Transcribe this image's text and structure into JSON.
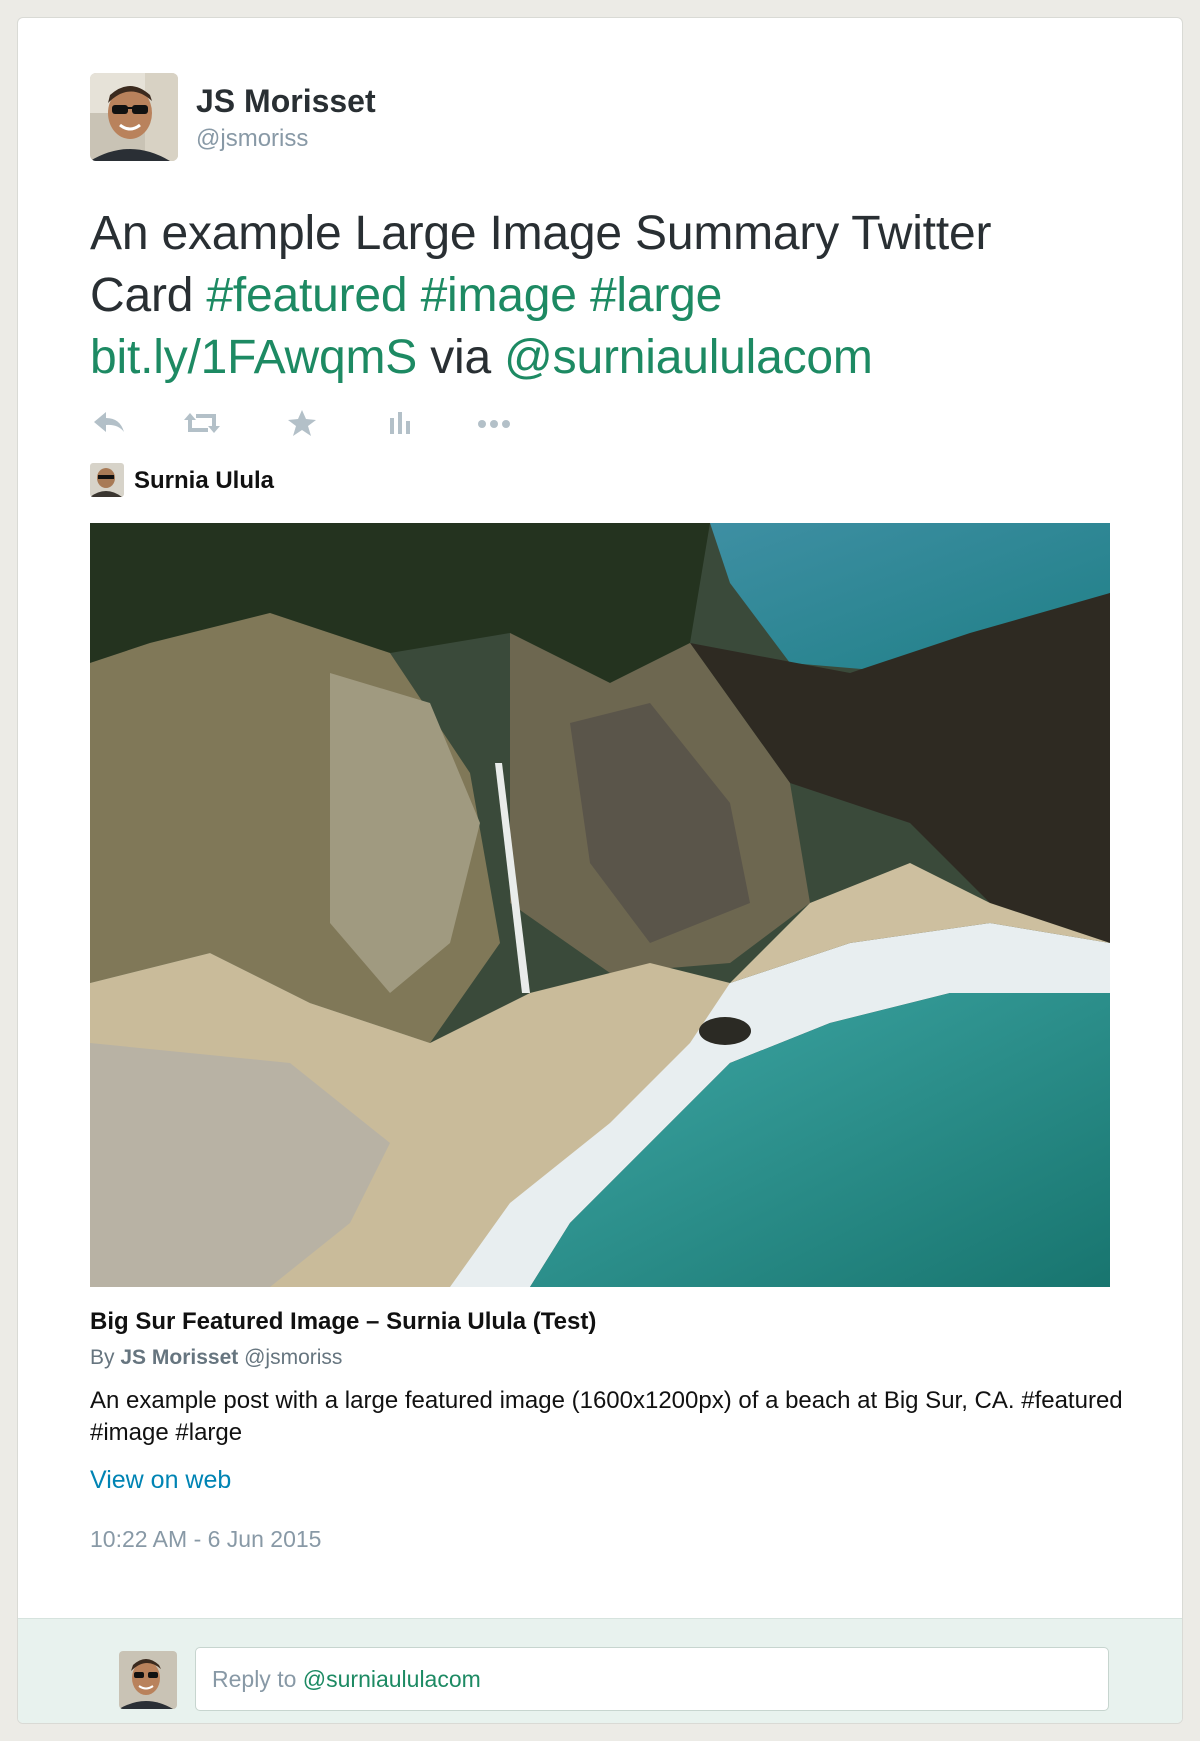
{
  "tweet": {
    "author_name": "JS Morisset",
    "author_handle": "@jsmoriss",
    "text_plain_1": "An example Large Image Summary Twitter Card",
    "hashtag_1": "#featured",
    "hashtag_2": "#image",
    "hashtag_3": "#large",
    "link": "bit.ly/1FAwqmS",
    "via_label": "via",
    "mention": "@surniaululacom"
  },
  "actions": [
    {
      "icon": "reply-icon"
    },
    {
      "icon": "retweet-icon"
    },
    {
      "icon": "favorite-star-icon"
    },
    {
      "icon": "analytics-bars-icon"
    },
    {
      "icon": "more-dots-icon"
    }
  ],
  "card": {
    "site_name": "Surnia Ulula",
    "title": "Big Sur Featured Image – Surnia Ulula (Test)",
    "by_label": "By",
    "creator_name": "JS Morisset",
    "creator_handle": "@jsmoriss",
    "description": "An example post with a large featured image (1600x1200px) of a beach at Big Sur, CA. #featured #image #large",
    "view_on_web": "View on web"
  },
  "timestamp": "10:22 AM - 6 Jun 2015",
  "reply": {
    "prefix": "Reply to",
    "mention": "@surniaululacom"
  },
  "colors": {
    "accent_green": "#1d8a63",
    "link_blue": "#0084b4",
    "muted": "#8899a6",
    "reply_bar_bg": "#e8f2ee"
  }
}
